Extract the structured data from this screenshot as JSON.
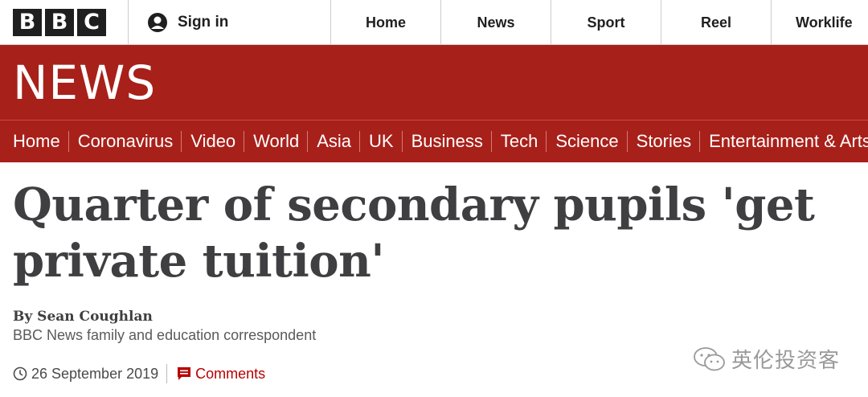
{
  "bbc_logo": [
    "B",
    "B",
    "C"
  ],
  "account": {
    "signin_label": "Sign in",
    "icon": "user-icon"
  },
  "top_nav": [
    "Home",
    "News",
    "Sport",
    "Reel",
    "Worklife"
  ],
  "brand": {
    "news_logo": "NEWS",
    "color": "#a8201a"
  },
  "section_nav": [
    "Home",
    "Coronavirus",
    "Video",
    "World",
    "Asia",
    "UK",
    "Business",
    "Tech",
    "Science",
    "Stories",
    "Entertainment & Arts"
  ],
  "article": {
    "headline": "Quarter of secondary pupils 'get private tuition'",
    "author": "By Sean Coughlan",
    "author_role": "BBC News family and education correspondent",
    "date": "26 September 2019",
    "comments_label": "Comments",
    "accent_color": "#b80000"
  },
  "watermark": {
    "text": "英伦投资客",
    "icon": "wechat-icon"
  }
}
